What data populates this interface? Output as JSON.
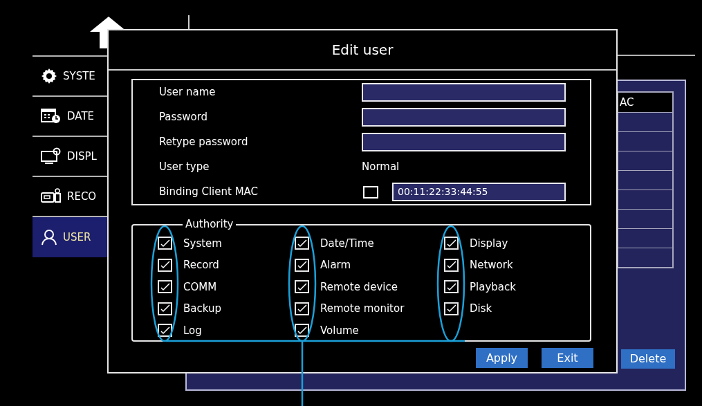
{
  "background": {
    "sidebar": [
      {
        "label": "SYSTE",
        "kind": "gear",
        "selected": false
      },
      {
        "label": "DATE",
        "kind": "calendar",
        "selected": false
      },
      {
        "label": "DISPL",
        "kind": "monitor",
        "selected": false
      },
      {
        "label": "RECO",
        "kind": "recorder",
        "selected": false
      },
      {
        "label": "USER",
        "kind": "user",
        "selected": true
      }
    ],
    "table": {
      "column_1": "AC"
    },
    "delete_button": "Delete"
  },
  "dialog": {
    "title": "Edit user",
    "fields": [
      {
        "label": "User name",
        "kind": "input"
      },
      {
        "label": "Password",
        "kind": "input"
      },
      {
        "label": "Retype password",
        "kind": "input"
      },
      {
        "label": "User type",
        "kind": "static",
        "value": "Normal"
      },
      {
        "label": "Binding Client MAC",
        "kind": "mac",
        "checked": false,
        "value": "00:11:22:33:44:55"
      }
    ],
    "authority": {
      "title": "Authority",
      "columns": [
        [
          {
            "label": "System",
            "checked": true
          },
          {
            "label": "Record",
            "checked": true
          },
          {
            "label": "COMM",
            "checked": true
          },
          {
            "label": "Backup",
            "checked": true
          },
          {
            "label": "Log",
            "checked": true
          }
        ],
        [
          {
            "label": "Date/Time",
            "checked": true
          },
          {
            "label": "Alarm",
            "checked": true
          },
          {
            "label": "Remote device",
            "checked": true
          },
          {
            "label": "Remote monitor",
            "checked": true
          },
          {
            "label": "Volume",
            "checked": true
          }
        ],
        [
          {
            "label": "Display",
            "checked": true
          },
          {
            "label": "Network",
            "checked": true
          },
          {
            "label": "Playback",
            "checked": true
          },
          {
            "label": "Disk",
            "checked": true
          }
        ]
      ]
    },
    "buttons": [
      "Apply",
      "Exit"
    ]
  }
}
